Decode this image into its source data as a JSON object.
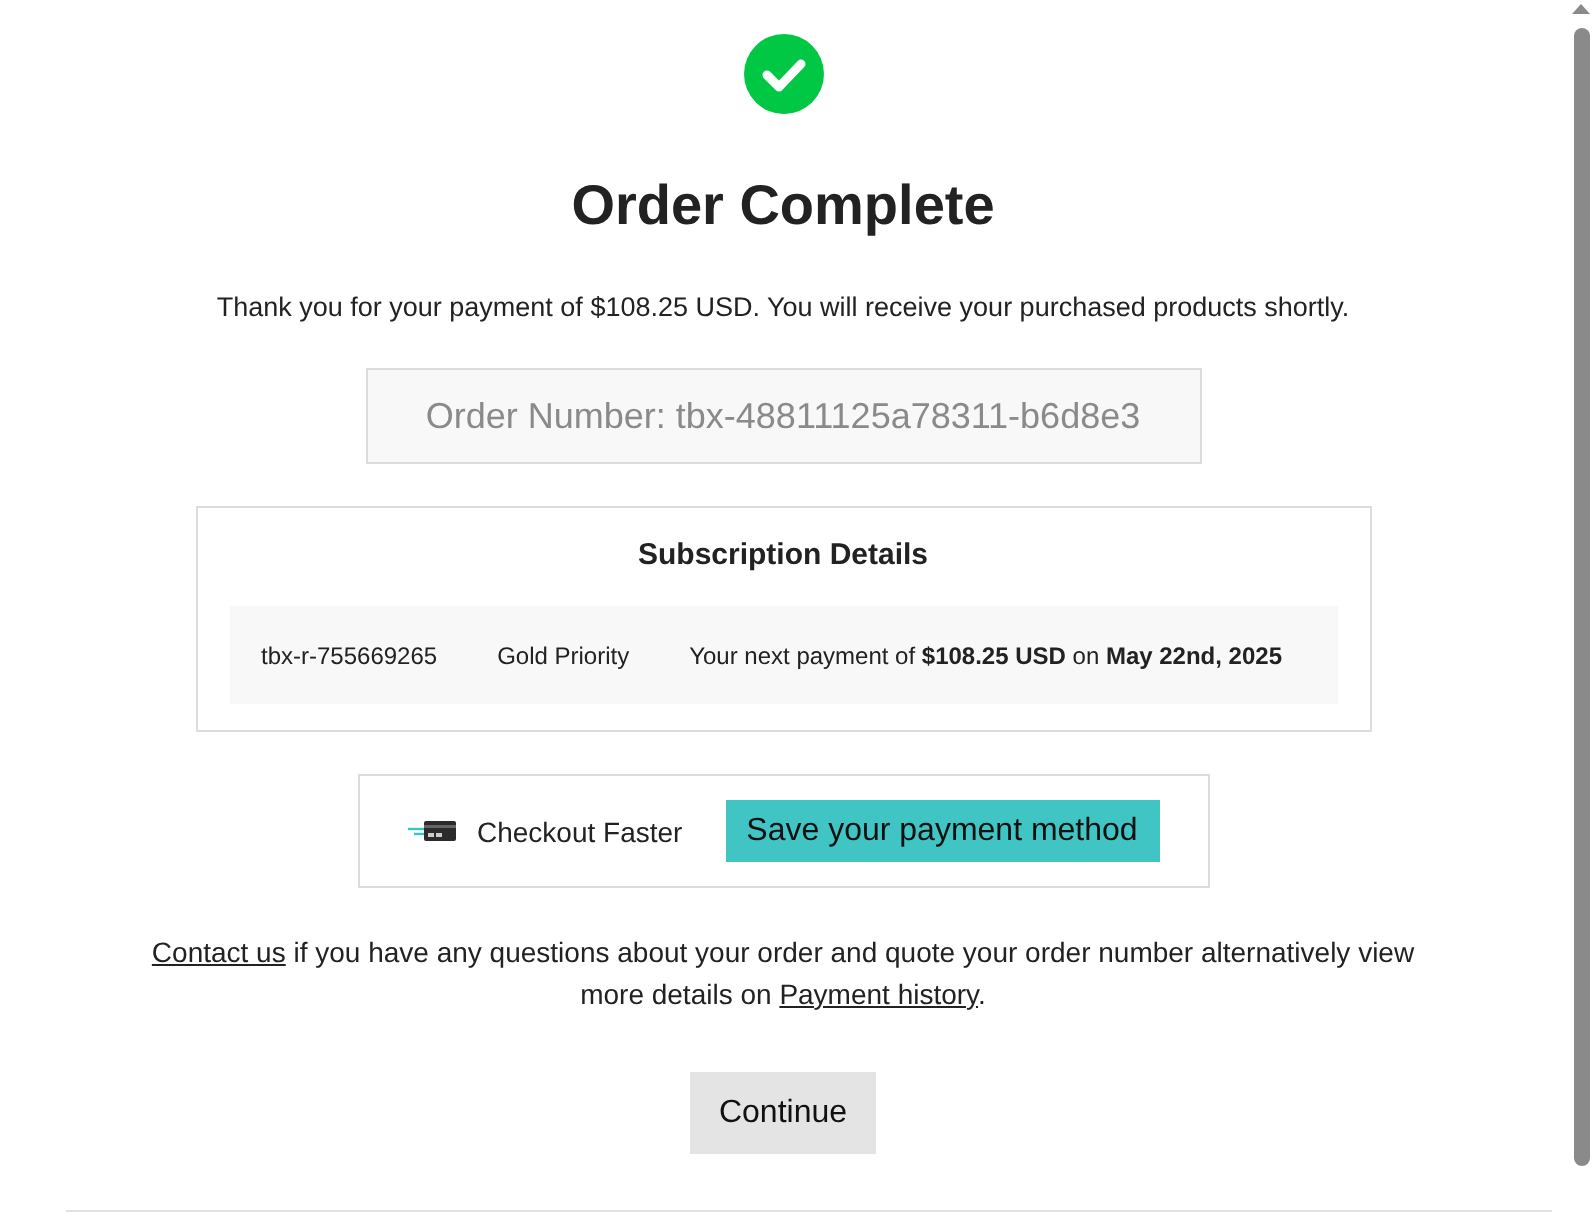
{
  "title": "Order Complete",
  "message": "Thank you for your payment of $108.25 USD. You will receive your purchased products shortly.",
  "order_number": "Order Number: tbx-48811125a78311-b6d8e3",
  "subscription": {
    "title": "Subscription Details",
    "items": [
      {
        "id": "tbx-r-755669265",
        "plan": "Gold Priority",
        "next_payment": "Your next payment of **$108.25 USD** on **May 22nd, 2025**"
      }
    ]
  },
  "checkout": {
    "label": "Checkout Faster",
    "button": "Save your payment method"
  },
  "help": [
    {
      "kind": "link",
      "text": "Contact us"
    },
    {
      "kind": "text",
      "text": " if you have any questions about your order and quote your order number alternatively view more details on "
    },
    {
      "kind": "link",
      "text": "Payment history"
    },
    {
      "kind": "text",
      "text": "."
    }
  ],
  "continue_button": "Continue"
}
